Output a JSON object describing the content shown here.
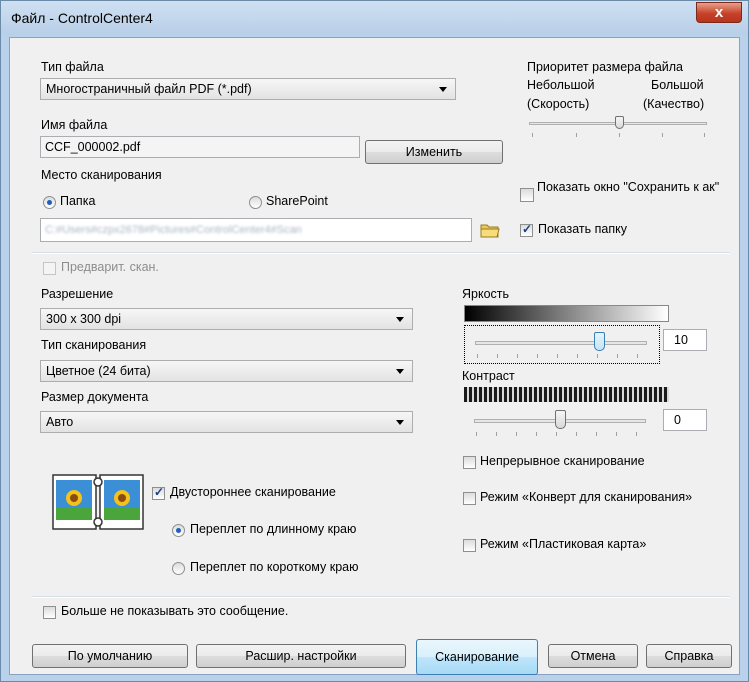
{
  "window": {
    "title": "Файл - ControlCenter4",
    "close_label": "x"
  },
  "file_type": {
    "label": "Тип файла",
    "value": "Многостраничный файл PDF (*.pdf)"
  },
  "file_size_priority": {
    "label": "Приоритет размера файла",
    "left_label": "Небольшой",
    "right_label": "Большой",
    "left_sub": "(Скорость)",
    "right_sub": "(Качество)"
  },
  "file_name": {
    "label": "Имя файла",
    "value": "CCF_000002.pdf",
    "change_button": "Изменить"
  },
  "scan_location": {
    "label": "Место сканирования",
    "folder_option": "Папка",
    "sharepoint_option": "SharePoint",
    "selected": "folder",
    "path_value": "C:#Users#czpx2678#Pictures#ControlCenter4#Scan"
  },
  "options_right": {
    "show_save_as_window": "Показать окно \"Сохранить к ак\"",
    "show_save_as_checked": false,
    "show_folder": "Показать папку",
    "show_folder_checked": true
  },
  "prescan": {
    "label": "Предварит. скан.",
    "checked": false,
    "enabled": false
  },
  "resolution": {
    "label": "Разрешение",
    "value": "300 x 300  dpi"
  },
  "scan_type": {
    "label": "Тип сканирования",
    "value": "Цветное (24 бита)"
  },
  "document_size": {
    "label": "Размер документа",
    "value": "Авто"
  },
  "brightness": {
    "label": "Яркость",
    "value": "10",
    "level": 0.72
  },
  "contrast": {
    "label": "Контраст",
    "value": "0",
    "level": 0.5
  },
  "continuous_scan": {
    "label": "Непрерывное сканирование",
    "checked": false
  },
  "carrier_sheet": {
    "label": "Режим «Конверт для сканирования»",
    "checked": false
  },
  "plastic_card": {
    "label": "Режим «Пластиковая карта»",
    "checked": false
  },
  "duplex": {
    "label": "Двустороннее сканирование",
    "checked": true,
    "long_edge": "Переплет по длинному краю",
    "short_edge": "Переплет по короткому краю",
    "selected": "long_edge"
  },
  "dont_show_again": {
    "label": "Больше не показывать это сообщение.",
    "checked": false
  },
  "buttons": {
    "default": "По умолчанию",
    "advanced": "Расшир. настройки",
    "scan": "Сканирование",
    "cancel": "Отмена",
    "help": "Справка"
  },
  "colors": {
    "title_bg": "#b9d1ea",
    "client_bg": "#f0f0f0",
    "close_red": "#c6432a",
    "accent": "#1f5fbf"
  },
  "icons": {
    "folder": "folder-icon",
    "duplex": "duplex-book-icon"
  }
}
